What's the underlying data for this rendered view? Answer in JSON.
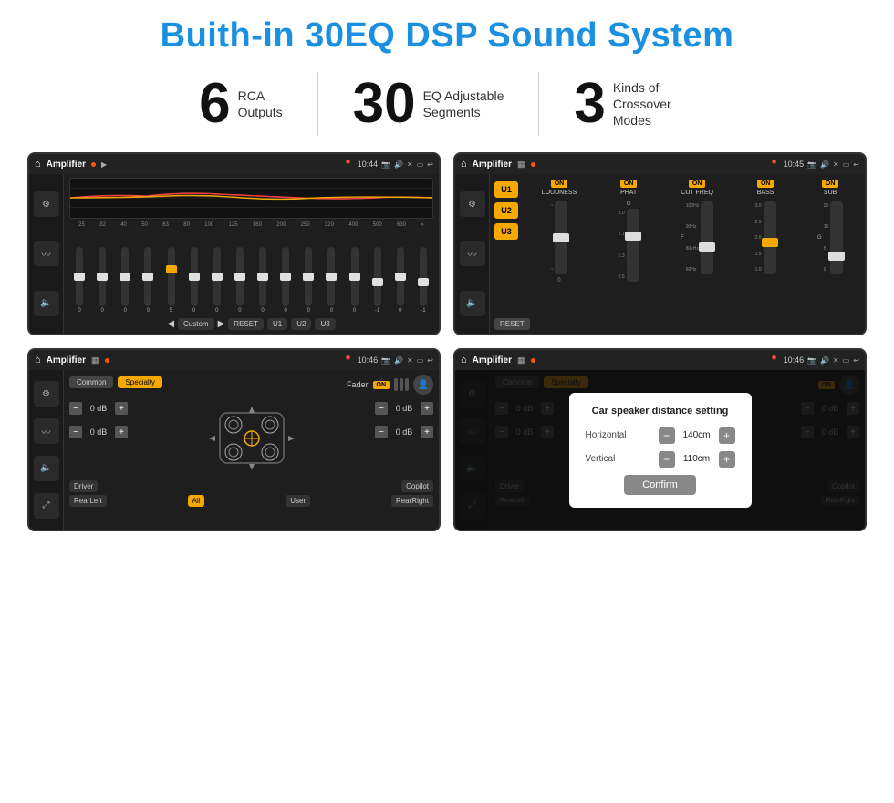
{
  "title": "Buith-in 30EQ DSP Sound System",
  "stats": [
    {
      "number": "6",
      "label_line1": "RCA",
      "label_line2": "Outputs"
    },
    {
      "number": "30",
      "label_line1": "EQ Adjustable",
      "label_line2": "Segments"
    },
    {
      "number": "3",
      "label_line1": "Kinds of",
      "label_line2": "Crossover Modes"
    }
  ],
  "screens": [
    {
      "id": "screen1",
      "time": "10:44",
      "title": "Amplifier",
      "type": "eq"
    },
    {
      "id": "screen2",
      "time": "10:45",
      "title": "Amplifier",
      "type": "crossover"
    },
    {
      "id": "screen3",
      "time": "10:46",
      "title": "Amplifier",
      "type": "fader"
    },
    {
      "id": "screen4",
      "time": "10:46",
      "title": "Amplifier",
      "type": "fader-dialog"
    }
  ],
  "eq": {
    "frequencies": [
      "25",
      "32",
      "40",
      "50",
      "63",
      "80",
      "100",
      "125",
      "160",
      "200",
      "250",
      "320",
      "400",
      "500",
      "630"
    ],
    "values": [
      "0",
      "0",
      "0",
      "0",
      "5",
      "0",
      "0",
      "0",
      "0",
      "0",
      "0",
      "0",
      "0",
      "-1",
      "0",
      "-1"
    ],
    "slider_positions": [
      50,
      50,
      50,
      50,
      35,
      50,
      50,
      50,
      50,
      50,
      50,
      50,
      50,
      60,
      50,
      60
    ],
    "buttons": [
      "Custom",
      "RESET",
      "U1",
      "U2",
      "U3"
    ]
  },
  "crossover": {
    "presets": [
      "U1",
      "U2",
      "U3"
    ],
    "channels": [
      {
        "toggle": "ON",
        "label": "LOUDNESS"
      },
      {
        "toggle": "ON",
        "label": "PHAT"
      },
      {
        "toggle": "ON",
        "label": "CUT FREQ"
      },
      {
        "toggle": "ON",
        "label": "BASS"
      },
      {
        "toggle": "ON",
        "label": "SUB"
      }
    ],
    "reset_label": "RESET"
  },
  "fader": {
    "tabs": [
      "Common",
      "Specialty"
    ],
    "active_tab": "Specialty",
    "fader_label": "Fader",
    "toggle_on": "ON",
    "positions": [
      {
        "label": "Driver",
        "active": false
      },
      {
        "label": "Copilot",
        "active": false
      },
      {
        "label": "RearLeft",
        "active": false
      },
      {
        "label": "All",
        "active": true
      },
      {
        "label": "User",
        "active": false
      },
      {
        "label": "RearRight",
        "active": false
      }
    ],
    "db_controls": [
      {
        "value": "0 dB"
      },
      {
        "value": "0 dB"
      },
      {
        "value": "0 dB"
      },
      {
        "value": "0 dB"
      }
    ]
  },
  "dialog": {
    "title": "Car speaker distance setting",
    "fields": [
      {
        "label": "Horizontal",
        "value": "140cm"
      },
      {
        "label": "Vertical",
        "value": "110cm"
      }
    ],
    "confirm_label": "Confirm"
  },
  "colors": {
    "accent": "#f5a800",
    "blue": "#1a90e0",
    "bg_dark": "#1a1a1a",
    "text_light": "#ffffff"
  }
}
